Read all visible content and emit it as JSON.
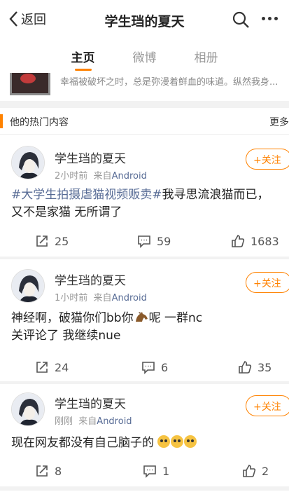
{
  "nav": {
    "back_label": "返回",
    "title": "学生珰的夏天"
  },
  "tabs": [
    {
      "label": "主页",
      "active": true
    },
    {
      "label": "微博",
      "active": false
    },
    {
      "label": "相册",
      "active": false
    }
  ],
  "prev_card": {
    "text": "幸福被破坏之时，总是弥漫着鲜血的味道。纵然我身..."
  },
  "section": {
    "label": "他的热门内容",
    "more": "更多"
  },
  "posts": [
    {
      "username": "学生珰的夏天",
      "time": "2小时前",
      "source_prefix": "来自",
      "source": "Android",
      "follow": "+关注",
      "hashtag": "#大学生拍摄虐猫视频贩卖#",
      "text": "我寻思流浪猫而已，又不是家猫 无所谓了",
      "repost": "25",
      "comment": "59",
      "like": "1683"
    },
    {
      "username": "学生珰的夏天",
      "time": "1小时前",
      "source_prefix": "来自",
      "source": "Android",
      "follow": "+关注",
      "text_a": "神经啊，破猫你们bb你",
      "text_b": "呢 一群nc",
      "text_c": "关评论了 我继续nue",
      "repost": "24",
      "comment": "6",
      "like": "35"
    },
    {
      "username": "学生珰的夏天",
      "time": "刚刚",
      "source_prefix": "来自",
      "source": "Android",
      "follow": "+关注",
      "text": "现在网友都没有自己脑子的",
      "repost": "8",
      "comment": "1",
      "like": "2"
    }
  ],
  "colors": {
    "accent": "#ff8200",
    "link": "#576b95",
    "background": "#f2f2f2"
  }
}
